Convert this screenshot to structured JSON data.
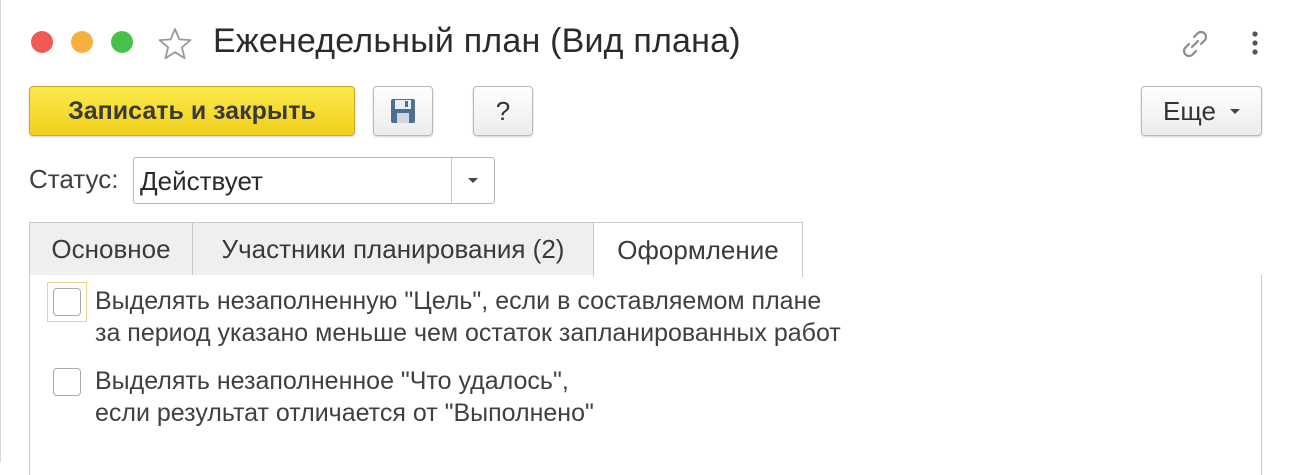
{
  "window": {
    "title": "Еженедельный план (Вид плана)"
  },
  "toolbar": {
    "save_close_label": "Записать и закрыть",
    "help_label": "?",
    "more_label": "Еще"
  },
  "status": {
    "label": "Статус:",
    "value": "Действует"
  },
  "tabs": [
    {
      "label": "Основное",
      "active": false
    },
    {
      "label": "Участники планирования (2)",
      "active": false
    },
    {
      "label": "Оформление",
      "active": true
    }
  ],
  "options": [
    {
      "line1": "Выделять незаполненную \"Цель\", если в составляемом плане",
      "line2": "за период указано меньше чем остаток запланированных работ",
      "checked": false
    },
    {
      "line1": "Выделять незаполненное \"Что удалось\",",
      "line2": "если результат отличается от \"Выполнено\"",
      "checked": false
    }
  ],
  "colors": {
    "close": "#ef5a55",
    "minimize": "#f4b140",
    "maximize": "#4bc04a",
    "primary_button": "#f5dc2e"
  }
}
